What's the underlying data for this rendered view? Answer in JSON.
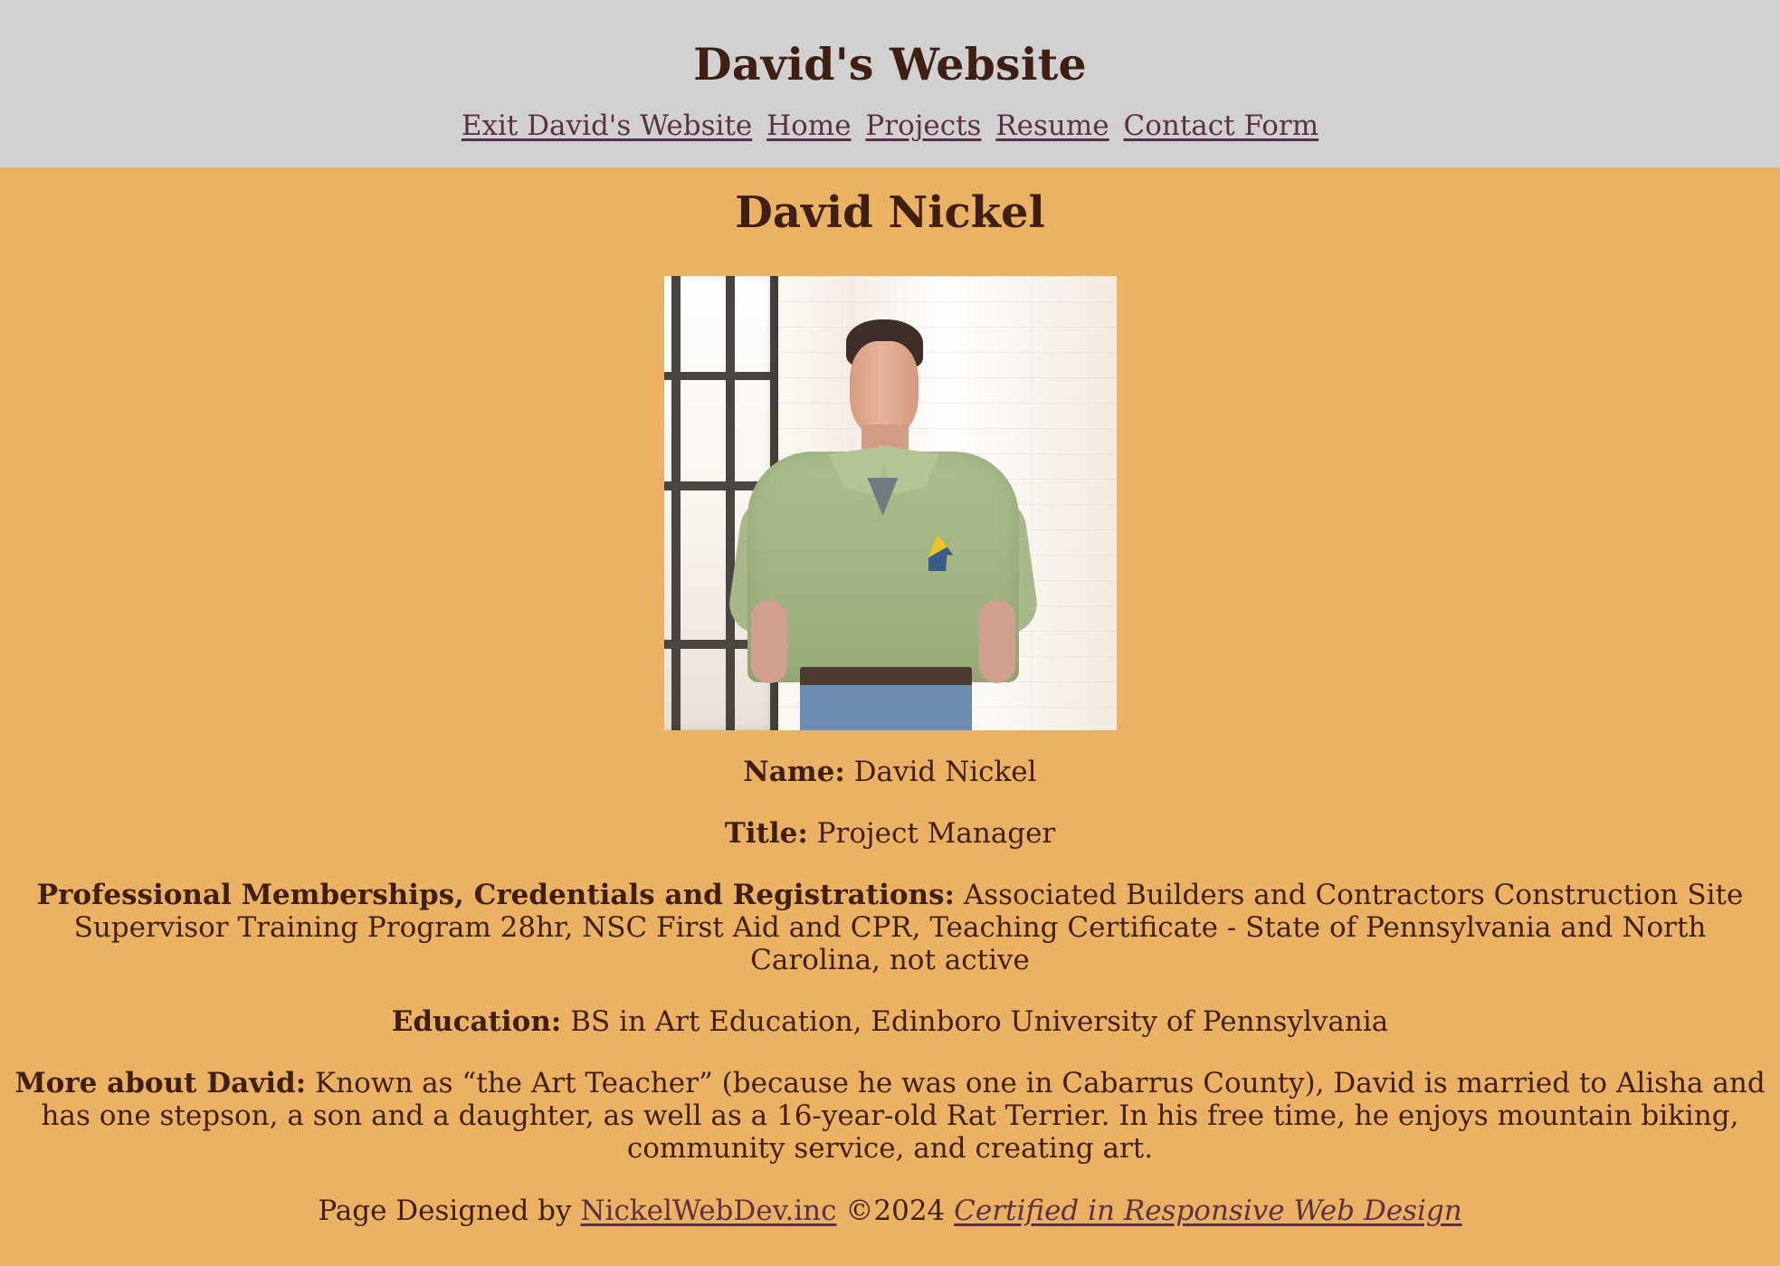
{
  "site": {
    "title": "David's Website"
  },
  "nav": {
    "items": [
      "Exit David's Website",
      "Home",
      "Projects",
      "Resume",
      "Contact Form"
    ]
  },
  "profile": {
    "heading": "David Nickel",
    "photo_alt": "David Nickel",
    "name_label": "Name:",
    "name_value": "David Nickel",
    "title_label": "Title:",
    "title_value": "Project Manager",
    "credentials_label": "Professional Memberships, Credentials and Registrations:",
    "credentials_value": "Associated Builders and Contractors Construction Site Supervisor Training Program 28hr, NSC First Aid and CPR, Teaching Certificate - State of Pennsylvania and North Carolina, not active",
    "education_label": "Education:",
    "education_value": "BS in Art Education, Edinboro University of Pennsylvania",
    "more_label": "More about David:",
    "more_value": "Known as “the Art Teacher” (because he was one in Cabarrus County), David is married to Alisha and has one stepson, a son and a daughter, as well as a 16-year-old Rat Terrier. In his free time, he enjoys mountain biking, community service, and creating art."
  },
  "footer": {
    "prefix": "Page Designed by",
    "company": "NickelWebDev.inc",
    "copyright": "©2024",
    "certification": "Certified in Responsive Web Design"
  }
}
